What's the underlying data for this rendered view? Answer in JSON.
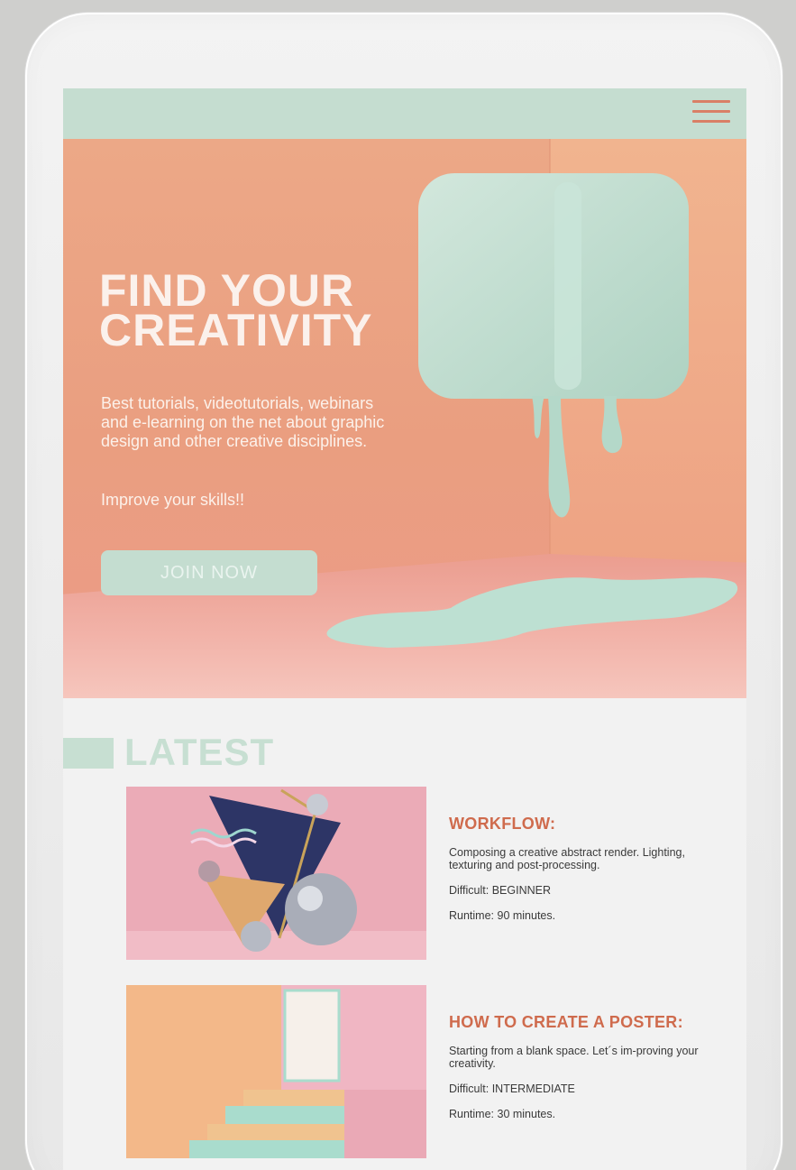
{
  "hero": {
    "title_line1": "FIND YOUR",
    "title_line2": "CREATIVITY",
    "description": "Best tutorials, videotutorials, webinars and e-learning on the net about graphic design and other creative disciplines.",
    "tagline": "Improve your skills!!",
    "cta_label": "JOIN NOW"
  },
  "latest": {
    "title": "LATEST",
    "cards": [
      {
        "heading": "WORKFLOW:",
        "description": "Composing a creative abstract render. Lighting, texturing and post-processing.",
        "difficulty": "Difficult: BEGINNER",
        "runtime": "Runtime: 90 minutes."
      },
      {
        "heading": "HOW TO CREATE A POSTER:",
        "description": "Starting from a blank space. Let´s im-proving your creativity.",
        "difficulty": "Difficult: INTERMEDIATE",
        "runtime": "Runtime: 30 minutes."
      }
    ]
  },
  "icons": {
    "menu": "hamburger-menu-icon"
  },
  "colors": {
    "mint": "#c5ddd0",
    "peach": "#eca887",
    "accent": "#cf6b4d"
  }
}
